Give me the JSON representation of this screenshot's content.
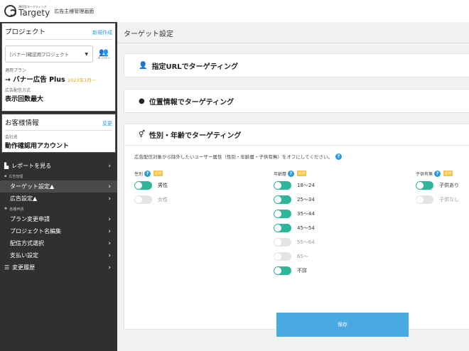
{
  "header": {
    "logo_sub": "運用型ターゲティング",
    "logo_name": "Targety",
    "title": "広告主様管理画面"
  },
  "sidebar": {
    "project": {
      "title": "プロジェクト",
      "new_link": "新規作成",
      "selected": "[バナー]確認用プロジェクト",
      "member_label": "メンバー",
      "plan_label": "適用プラン",
      "plan_value": "→ バナー広告 Plus",
      "plan_date": "2023年1月〜",
      "delivery_label": "広告配信方式",
      "delivery_value": "表示回数最大"
    },
    "customer": {
      "title": "お客様情報",
      "edit_link": "変更",
      "company_label": "会社名",
      "company_value": "動作確認用アカウント"
    },
    "nav": {
      "report": "レポートを見る",
      "ads_head": "広告管理",
      "target": "ターゲット設定▲",
      "ad_setting": "広告設定▲",
      "apply_head": "各種申請",
      "plan_change": "プラン変更申請",
      "project_edit": "プロジェクト名編集",
      "delivery_select": "配信方式選択",
      "payment": "支払い設定",
      "history": "変更履歴"
    }
  },
  "main": {
    "page_title": "ターゲット設定",
    "card_url": "指定URLでターゲティング",
    "card_geo": "位置情報でターゲティング",
    "card_demo": "性別・年齢でターゲティング",
    "description": "広告配信対象から除外したいユーザー属性（性別・年齢層・子供有無）をオフにしてください。",
    "required_label": "必須",
    "gender": {
      "label": "性別",
      "options": [
        {
          "label": "男性",
          "on": true
        },
        {
          "label": "女性",
          "on": false
        }
      ]
    },
    "age": {
      "label": "年齢層",
      "options": [
        {
          "label": "18〜24",
          "on": true
        },
        {
          "label": "25〜34",
          "on": true
        },
        {
          "label": "35〜44",
          "on": true
        },
        {
          "label": "45〜54",
          "on": true
        },
        {
          "label": "55〜64",
          "on": false
        },
        {
          "label": "65〜",
          "on": false
        },
        {
          "label": "不詳",
          "on": true
        }
      ]
    },
    "children": {
      "label": "子供有無",
      "options": [
        {
          "label": "子供あり",
          "on": true
        },
        {
          "label": "子供なし",
          "on": false
        }
      ]
    },
    "save_label": "保存"
  },
  "colors": {
    "accent": "#2b9bd7",
    "toggle_on": "#2fb69a",
    "sidebar_bg": "#303030",
    "plan_date": "#e3a318"
  }
}
